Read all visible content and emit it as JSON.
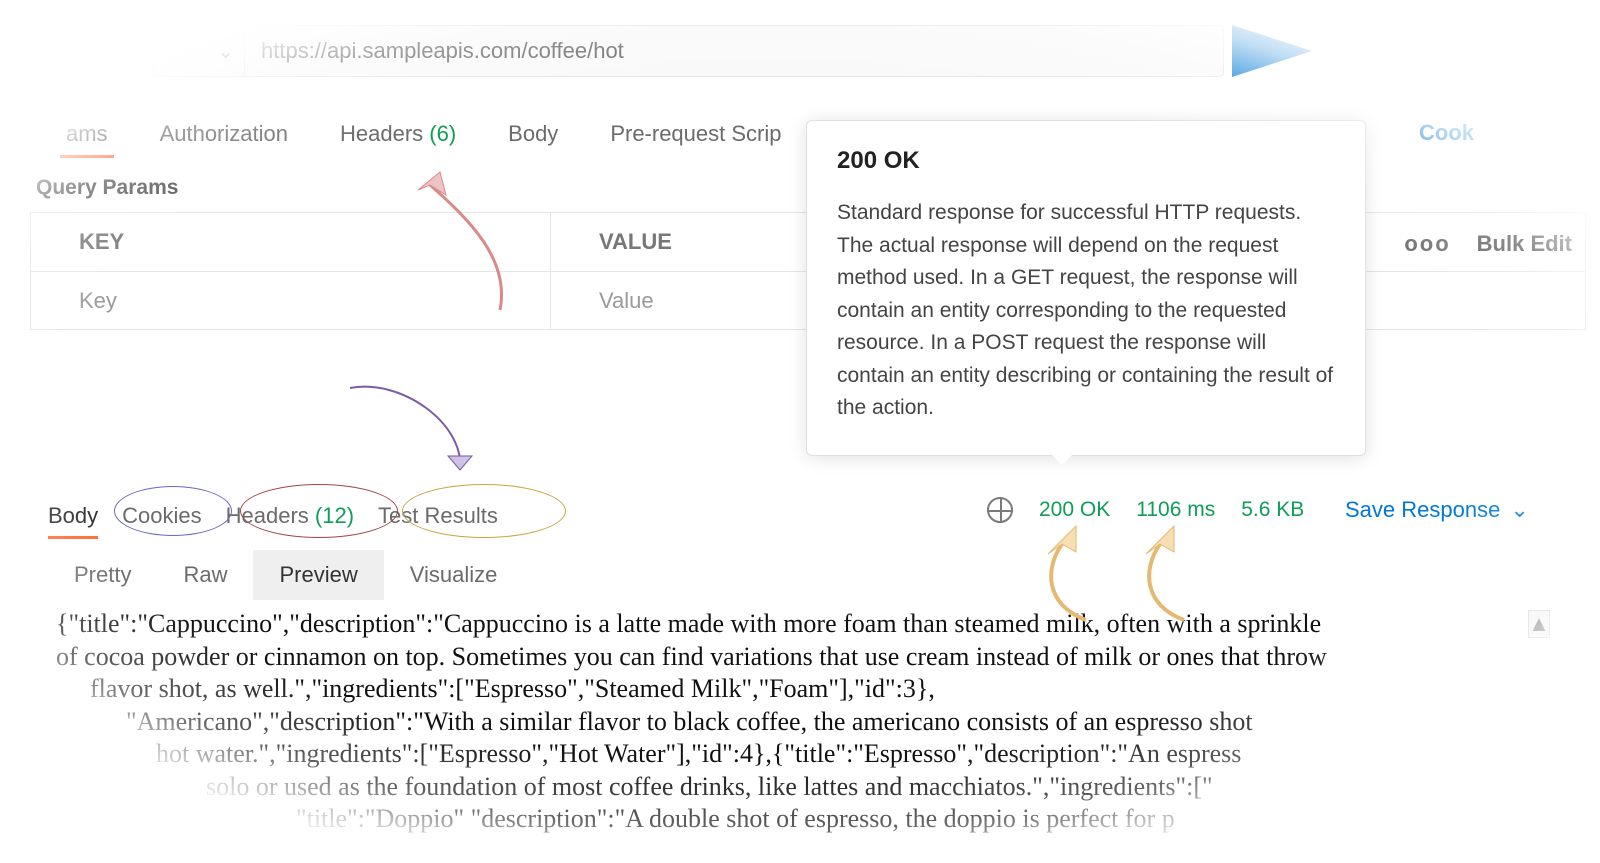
{
  "url_bar": {
    "url": "https://api.sampleapis.com/coffee/hot",
    "chevron": "⌄"
  },
  "request_tabs": {
    "params": "ams",
    "authorization": "Authorization",
    "headers": "Headers",
    "headers_count": "(6)",
    "body": "Body",
    "pre_request": "Pre-request Scrip",
    "cookies": "Cook"
  },
  "section_label": "Query Params",
  "params_table": {
    "key_header": "KEY",
    "value_header": "VALUE",
    "key_placeholder": "Key",
    "value_placeholder": "Value",
    "more": "ooo",
    "bulk_edit": "Bulk Edit"
  },
  "tooltip": {
    "title": "200 OK",
    "body": "Standard response for successful HTTP requests. The actual response will depend on the request method used. In a GET request, the response will contain an entity corresponding to the requested resource. In a POST request the response will contain an entity describing or containing the result of the action."
  },
  "response_tabs": {
    "body": "Body",
    "cookies": "Cookies",
    "headers": "Headers",
    "headers_count": "(12)",
    "test_results": "Test Results"
  },
  "status_bar": {
    "status": "200 OK",
    "time": "1106 ms",
    "size": "5.6 KB",
    "save_response": "Save Response"
  },
  "view_tabs": {
    "pretty": "Pretty",
    "raw": "Raw",
    "preview": "Preview",
    "visualize": "Visualize"
  },
  "preview_lines": {
    "l1": "{\"title\":\"Cappuccino\",\"description\":\"Cappuccino is a latte made with more foam than steamed milk, often with a sprinkle",
    "l2": "of cocoa powder or cinnamon on top. Sometimes you can find variations that use cream instead of milk or ones that throw",
    "l3": "flavor shot, as well.\",\"ingredients\":[\"Espresso\",\"Steamed Milk\",\"Foam\"],\"id\":3},",
    "l4": "\"Americano\",\"description\":\"With a similar flavor to black coffee, the americano consists of an espresso shot",
    "l5": "hot water.\",\"ingredients\":[\"Espresso\",\"Hot Water\"],\"id\":4},{\"title\":\"Espresso\",\"description\":\"An espress",
    "l6": "solo or used as the foundation of most coffee drinks, like lattes and macchiatos.\",\"ingredients\":[\"",
    "l7": "\"title\":\"Doppio\" \"description\":\"A double shot of espresso, the doppio is perfect for p"
  },
  "scroll_glyph": "▲"
}
